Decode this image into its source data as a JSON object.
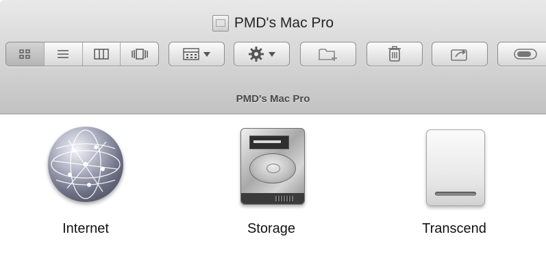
{
  "window": {
    "title": "PMD's Mac Pro"
  },
  "toolbar": {
    "view_modes": [
      {
        "name": "icon-view",
        "icon": "grid-icon",
        "selected": true
      },
      {
        "name": "list-view",
        "icon": "list-icon",
        "selected": false
      },
      {
        "name": "column-view",
        "icon": "columns-icon",
        "selected": false
      },
      {
        "name": "cover-flow-view",
        "icon": "coverflow-icon",
        "selected": false
      }
    ],
    "buttons": [
      {
        "name": "arrange-button",
        "icon": "arrange-grid-icon",
        "dropdown": true
      },
      {
        "name": "action-button",
        "icon": "gear-icon",
        "dropdown": true
      },
      {
        "name": "new-folder-button",
        "icon": "new-folder-icon",
        "dropdown": false
      },
      {
        "name": "delete-button",
        "icon": "trash-icon",
        "dropdown": false
      },
      {
        "name": "share-button",
        "icon": "share-icon",
        "dropdown": false
      },
      {
        "name": "toggle-button",
        "icon": "toggle-pill-icon",
        "dropdown": false
      }
    ]
  },
  "pathbar": {
    "label": "PMD's Mac Pro"
  },
  "items": [
    {
      "label": "Internet",
      "icon": "network-globe-icon"
    },
    {
      "label": "Storage",
      "icon": "hard-drive-icon"
    },
    {
      "label": "Transcend",
      "icon": "external-drive-icon"
    }
  ],
  "colors": {
    "toolbar_top": "#e9e9e9",
    "toolbar_bottom": "#c2c2c2",
    "content_bg": "#ffffff"
  }
}
